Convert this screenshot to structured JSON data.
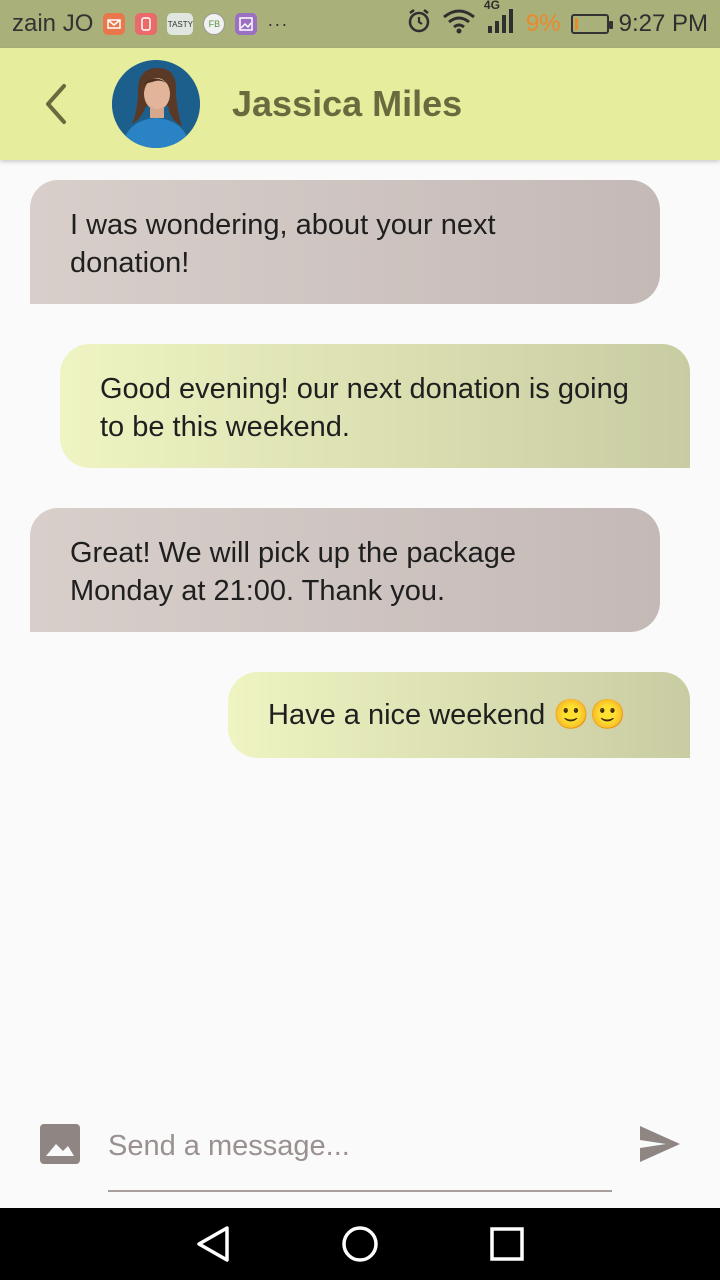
{
  "status_bar": {
    "carrier": "zain JO",
    "notification_icons": [
      "mail-icon",
      "app-icon",
      "tasty-icon",
      "fb-icon",
      "gallery-icon"
    ],
    "noti_tasty": "TASTY",
    "noti_fb": "FB",
    "more": "···",
    "network": "4G",
    "battery_percent": "9%",
    "time": "9:27 PM"
  },
  "header": {
    "contact_name": "Jassica Miles",
    "accent_color": "#e6ed9c",
    "name_color": "#6a6a3f"
  },
  "messages": [
    {
      "from": "contact",
      "text": "I was wondering, about your next donation!"
    },
    {
      "from": "me",
      "text": "Good evening! our next donation is going to be this weekend."
    },
    {
      "from": "contact",
      "text": "Great! We will pick up the package Monday at 21:00. Thank you."
    },
    {
      "from": "me",
      "text": "Have a nice weekend 🙂🙂"
    }
  ],
  "composer": {
    "placeholder": "Send a message...",
    "value": ""
  },
  "nav": {
    "icons": [
      "back-triangle-icon",
      "home-circle-icon",
      "recents-square-icon"
    ]
  }
}
